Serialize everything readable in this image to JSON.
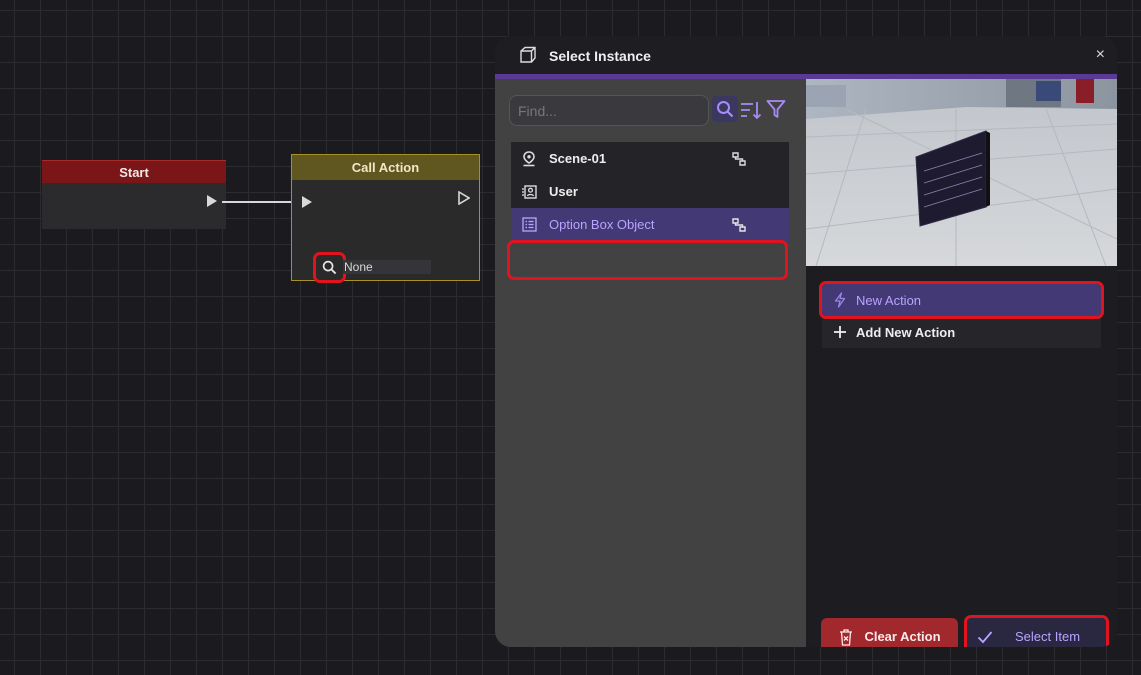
{
  "graph": {
    "start_node": {
      "title": "Start"
    },
    "call_node": {
      "title": "Call Action",
      "target_value": "None"
    }
  },
  "dialog": {
    "title": "Select Instance",
    "close_label": "×",
    "search": {
      "placeholder": "Find...",
      "value": ""
    },
    "instances": [
      {
        "label": "Scene-01",
        "icon": "location-pin-icon",
        "has_link": true
      },
      {
        "label": "User",
        "icon": "user-card-icon",
        "has_link": false
      },
      {
        "label": "Option Box Object",
        "icon": "list-icon",
        "has_link": true,
        "selected": true
      }
    ],
    "actions": [
      {
        "label": "New Action",
        "icon": "lightning-icon",
        "selected": true
      },
      {
        "label": "Add New Action",
        "icon": "plus-icon"
      }
    ],
    "buttons": {
      "clear": "Clear Action",
      "select": "Select Item"
    }
  },
  "colors": {
    "accent": "#5a3a95",
    "selected_bg": "#433975",
    "selected_text": "#b9a4ff",
    "danger": "#a1282c",
    "highlight": "#e0131f"
  }
}
